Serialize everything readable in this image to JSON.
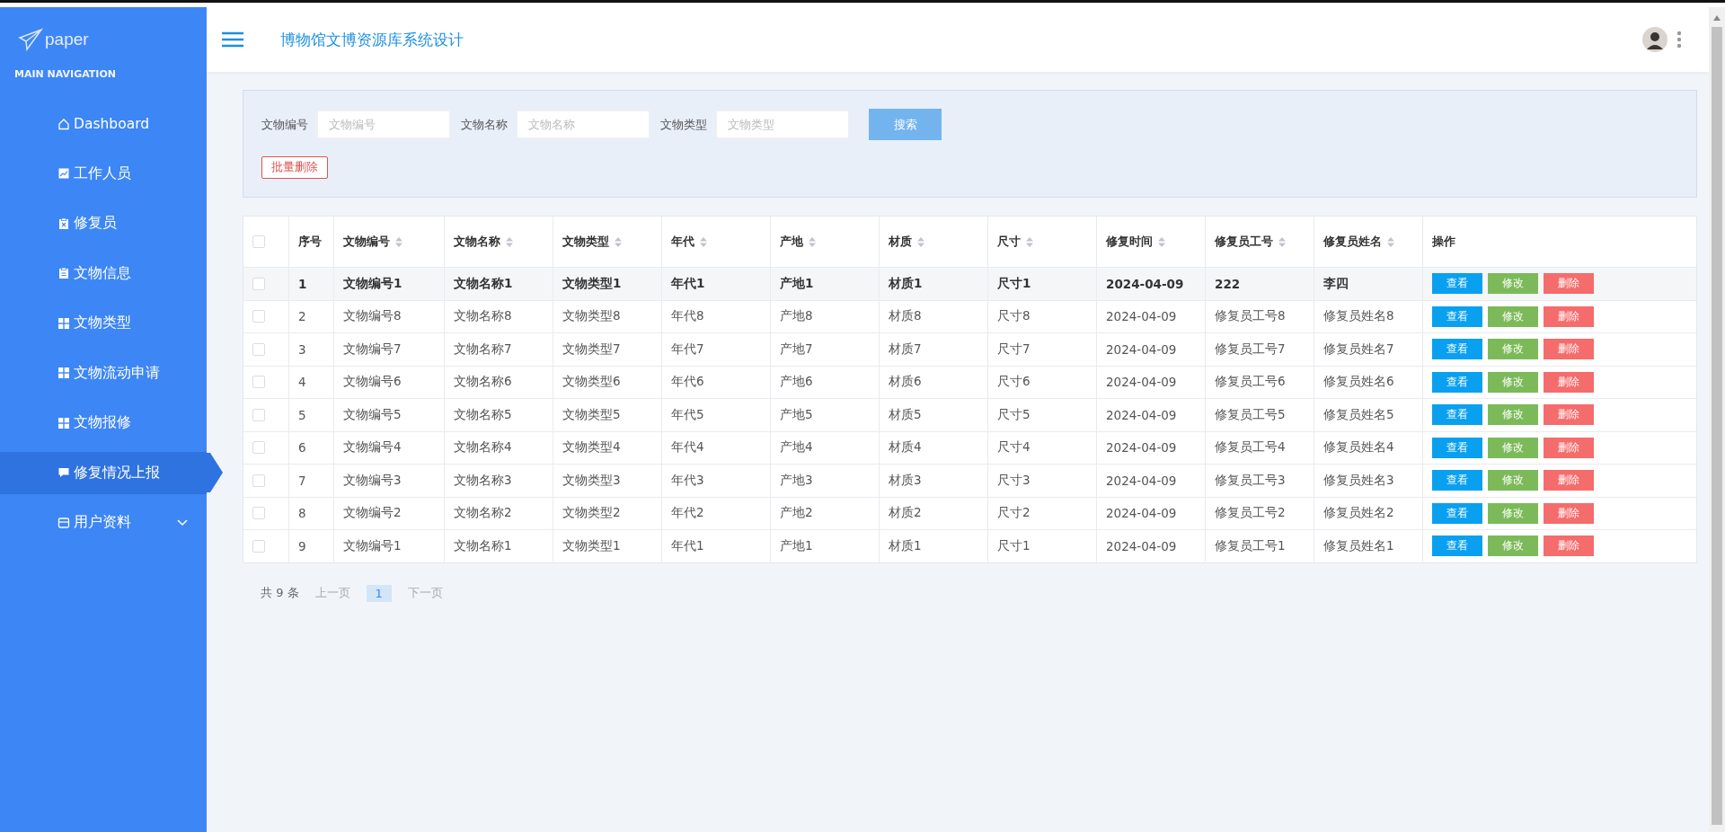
{
  "sidebar": {
    "logo": "paper",
    "section_title": "MAIN NAVIGATION",
    "items": [
      {
        "label": "Dashboard",
        "selected": false
      },
      {
        "label": "工作人员",
        "selected": false
      },
      {
        "label": "修复员",
        "selected": false
      },
      {
        "label": "文物信息",
        "selected": false
      },
      {
        "label": "文物类型",
        "selected": false
      },
      {
        "label": "文物流动申请",
        "selected": false
      },
      {
        "label": "文物报修",
        "selected": false
      },
      {
        "label": "修复情况上报",
        "selected": true
      },
      {
        "label": "用户资料",
        "selected": false,
        "expanded": false
      }
    ]
  },
  "header": {
    "title": "博物馆文博资源库系统设计"
  },
  "search": {
    "fields": [
      {
        "label": "文物编号",
        "placeholder": "文物编号"
      },
      {
        "label": "文物名称",
        "placeholder": "文物名称"
      },
      {
        "label": "文物类型",
        "placeholder": "文物类型"
      }
    ],
    "search_button": "搜索",
    "batch_delete_button": "批量删除"
  },
  "table": {
    "columns": [
      {
        "label": "序号",
        "sortable": false
      },
      {
        "label": "文物编号",
        "sortable": true
      },
      {
        "label": "文物名称",
        "sortable": true
      },
      {
        "label": "文物类型",
        "sortable": true
      },
      {
        "label": "年代",
        "sortable": true
      },
      {
        "label": "产地",
        "sortable": true
      },
      {
        "label": "材质",
        "sortable": true
      },
      {
        "label": "尺寸",
        "sortable": true
      },
      {
        "label": "修复时间",
        "sortable": true
      },
      {
        "label": "修复员工号",
        "sortable": true
      },
      {
        "label": "修复员姓名",
        "sortable": true
      },
      {
        "label": "操作",
        "sortable": false
      }
    ],
    "all_checked": false,
    "rows": [
      {
        "selected": true,
        "checked": false,
        "cells": [
          "1",
          "文物编号1",
          "文物名称1",
          "文物类型1",
          "年代1",
          "产地1",
          "材质1",
          "尺寸1",
          "2024-04-09",
          "222",
          "李四"
        ],
        "actions": [
          "查看",
          "修改",
          "删除"
        ]
      },
      {
        "selected": false,
        "checked": false,
        "cells": [
          "2",
          "文物编号8",
          "文物名称8",
          "文物类型8",
          "年代8",
          "产地8",
          "材质8",
          "尺寸8",
          "2024-04-09",
          "修复员工号8",
          "修复员姓名8"
        ],
        "actions": [
          "查看",
          "修改",
          "删除"
        ]
      },
      {
        "selected": false,
        "checked": false,
        "cells": [
          "3",
          "文物编号7",
          "文物名称7",
          "文物类型7",
          "年代7",
          "产地7",
          "材质7",
          "尺寸7",
          "2024-04-09",
          "修复员工号7",
          "修复员姓名7"
        ],
        "actions": [
          "查看",
          "修改",
          "删除"
        ]
      },
      {
        "selected": false,
        "checked": false,
        "cells": [
          "4",
          "文物编号6",
          "文物名称6",
          "文物类型6",
          "年代6",
          "产地6",
          "材质6",
          "尺寸6",
          "2024-04-09",
          "修复员工号6",
          "修复员姓名6"
        ],
        "actions": [
          "查看",
          "修改",
          "删除"
        ]
      },
      {
        "selected": false,
        "checked": false,
        "cells": [
          "5",
          "文物编号5",
          "文物名称5",
          "文物类型5",
          "年代5",
          "产地5",
          "材质5",
          "尺寸5",
          "2024-04-09",
          "修复员工号5",
          "修复员姓名5"
        ],
        "actions": [
          "查看",
          "修改",
          "删除"
        ]
      },
      {
        "selected": false,
        "checked": false,
        "cells": [
          "6",
          "文物编号4",
          "文物名称4",
          "文物类型4",
          "年代4",
          "产地4",
          "材质4",
          "尺寸4",
          "2024-04-09",
          "修复员工号4",
          "修复员姓名4"
        ],
        "actions": [
          "查看",
          "修改",
          "删除"
        ]
      },
      {
        "selected": false,
        "checked": false,
        "cells": [
          "7",
          "文物编号3",
          "文物名称3",
          "文物类型3",
          "年代3",
          "产地3",
          "材质3",
          "尺寸3",
          "2024-04-09",
          "修复员工号3",
          "修复员姓名3"
        ],
        "actions": [
          "查看",
          "修改",
          "删除"
        ]
      },
      {
        "selected": false,
        "checked": false,
        "cells": [
          "8",
          "文物编号2",
          "文物名称2",
          "文物类型2",
          "年代2",
          "产地2",
          "材质2",
          "尺寸2",
          "2024-04-09",
          "修复员工号2",
          "修复员姓名2"
        ],
        "actions": [
          "查看",
          "修改",
          "删除"
        ]
      },
      {
        "selected": false,
        "checked": false,
        "cells": [
          "9",
          "文物编号1",
          "文物名称1",
          "文物类型1",
          "年代1",
          "产地1",
          "材质1",
          "尺寸1",
          "2024-04-09",
          "修复员工号1",
          "修复员姓名1"
        ],
        "actions": [
          "查看",
          "修改",
          "删除"
        ]
      }
    ]
  },
  "pagination": {
    "total": "共 9 条",
    "prev": "上一页",
    "pages": [
      {
        "label": "1",
        "selected": true
      }
    ],
    "next": "下一页"
  }
}
